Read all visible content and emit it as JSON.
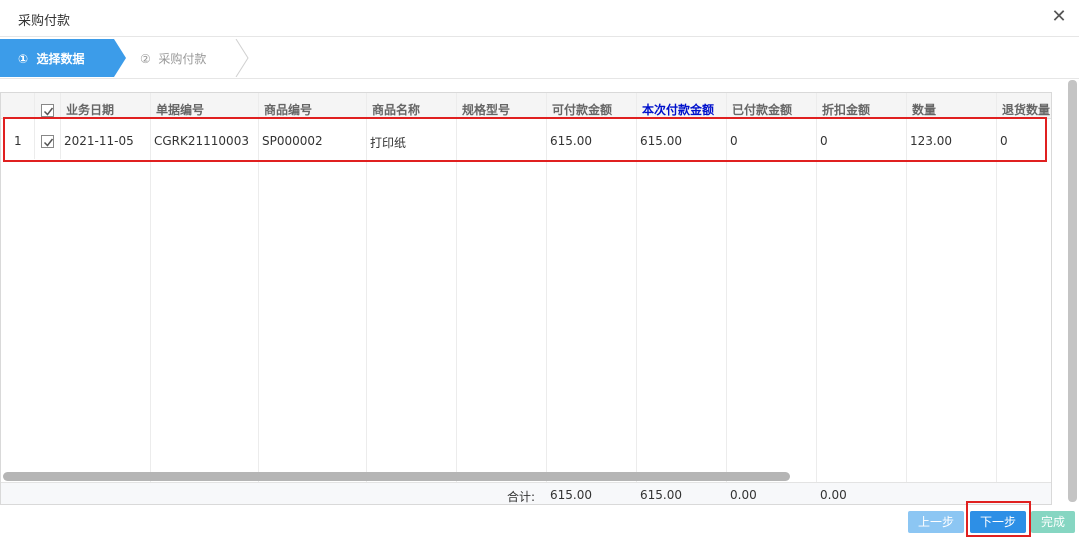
{
  "dialog": {
    "title": "采购付款"
  },
  "steps": [
    {
      "num": "①",
      "label": "选择数据"
    },
    {
      "num": "②",
      "label": "采购付款"
    }
  ],
  "table": {
    "columns": [
      "业务日期",
      "单据编号",
      "商品编号",
      "商品名称",
      "规格型号",
      "可付款金额",
      "本次付款金额",
      "已付款金额",
      "折扣金额",
      "数量",
      "退货数量"
    ],
    "rows": [
      {
        "index": "1",
        "date": "2021-11-05",
        "bill_no": "CGRK21110003",
        "goods_no": "SP000002",
        "goods_name": "打印纸",
        "spec": "",
        "payable": "615.00",
        "pay_now": "615.00",
        "paid": "0",
        "discount": "0",
        "qty": "123.00",
        "return_qty": "0"
      }
    ],
    "footer": {
      "label": "合计:",
      "payable": "615.00",
      "pay_now": "615.00",
      "paid": "0.00",
      "discount": "0.00"
    }
  },
  "buttons": {
    "prev": "上一步",
    "next": "下一步",
    "done": "完成"
  },
  "colors": {
    "accent": "#3c9ce9",
    "highlight": "#e02020"
  }
}
